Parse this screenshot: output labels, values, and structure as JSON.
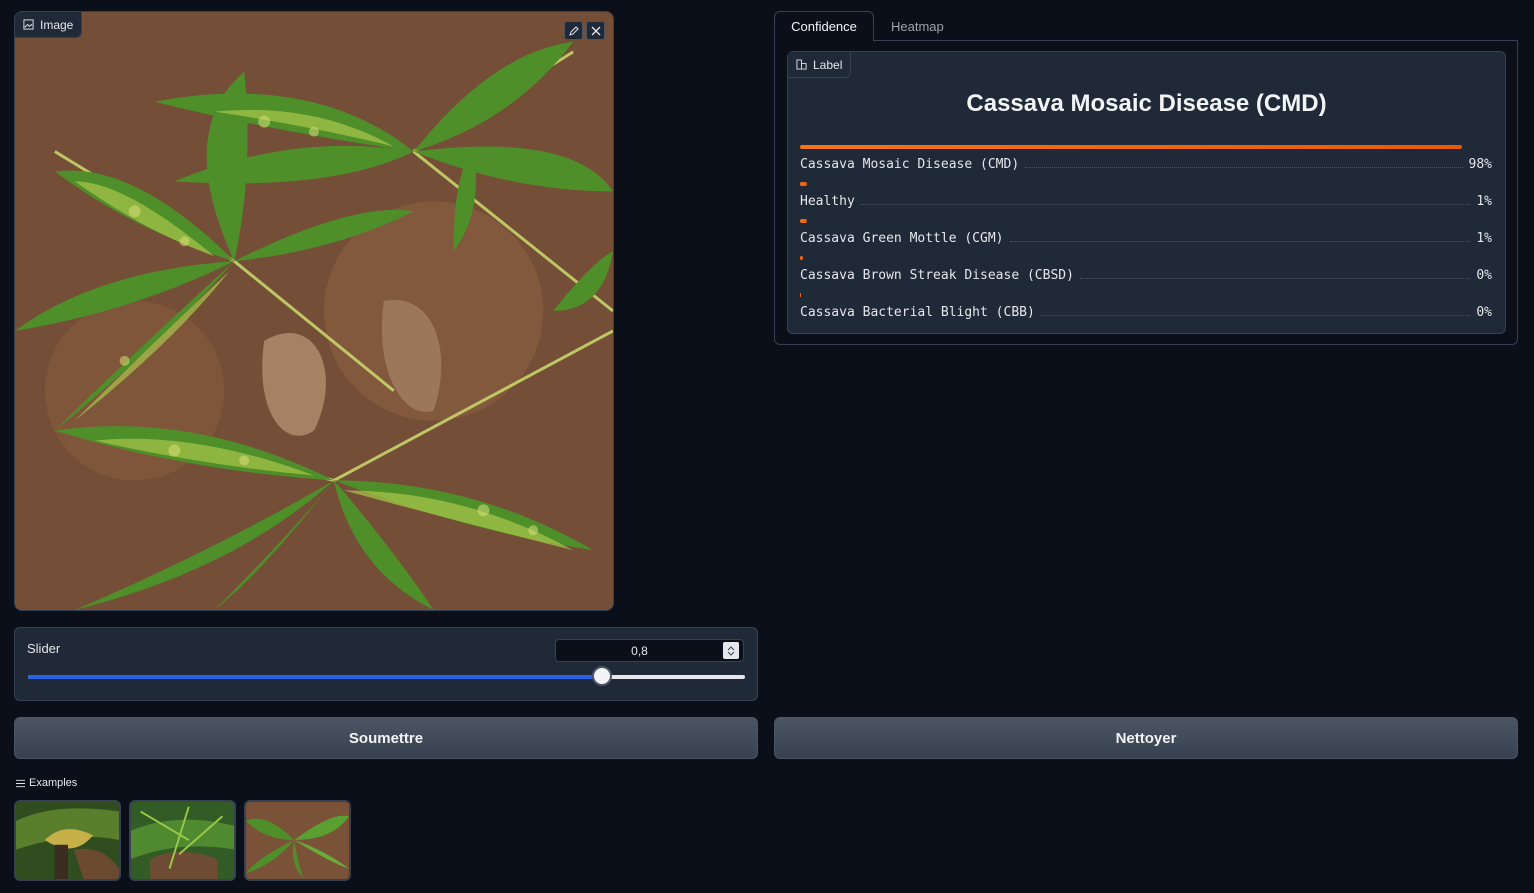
{
  "image_input": {
    "label": "Image",
    "icon": "image-icon",
    "tools": [
      "edit-icon",
      "close-icon"
    ]
  },
  "slider": {
    "label": "Slider",
    "value_display": "0,8",
    "value": 0.8,
    "min": 0,
    "max": 1,
    "accent": "#2563eb"
  },
  "buttons": {
    "submit": "Soumettre",
    "clear": "Nettoyer"
  },
  "examples": {
    "label": "Examples",
    "items": [
      "example-1",
      "example-2",
      "example-3"
    ]
  },
  "tabs": [
    {
      "label": "Confidence",
      "active": true
    },
    {
      "label": "Heatmap",
      "active": false
    }
  ],
  "output": {
    "label": "Label",
    "prediction": "Cassava Mosaic Disease (CMD)",
    "accent": "#ea580c",
    "confidences": [
      {
        "name": "Cassava Mosaic Disease (CMD)",
        "percent": "98%",
        "value": 0.98
      },
      {
        "name": "Healthy",
        "percent": "1%",
        "value": 0.01
      },
      {
        "name": "Cassava Green Mottle (CGM)",
        "percent": "1%",
        "value": 0.01
      },
      {
        "name": "Cassava Brown Streak Disease (CBSD)",
        "percent": "0%",
        "value": 0.005
      },
      {
        "name": "Cassava Bacterial Blight (CBB)",
        "percent": "0%",
        "value": 0.0
      }
    ]
  }
}
